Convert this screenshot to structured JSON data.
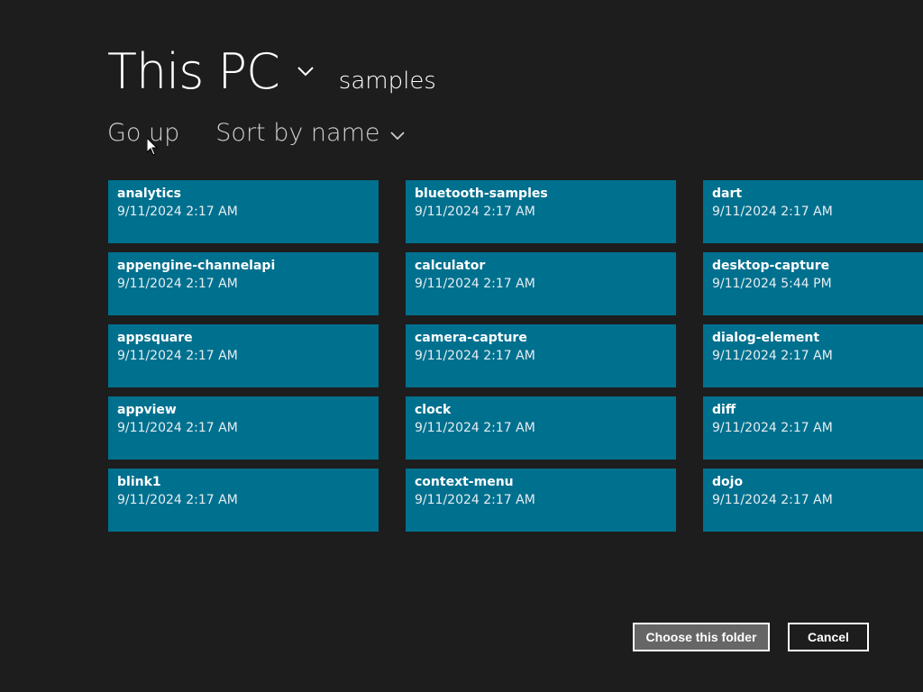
{
  "header": {
    "location": "This PC",
    "location_chevron_icon": "chevron-down-icon",
    "folder": "samples"
  },
  "commands": {
    "go_up": "Go up",
    "sort": "Sort by name",
    "sort_chevron_icon": "chevron-down-icon"
  },
  "colors": {
    "background": "#1d1d1d",
    "tile": "#00708f",
    "choose_button_bg": "#666666"
  },
  "folders": {
    "col1": [
      {
        "name": "analytics",
        "date": "9/11/2024 2:17 AM"
      },
      {
        "name": "appengine-channelapi",
        "date": "9/11/2024 2:17 AM"
      },
      {
        "name": "appsquare",
        "date": "9/11/2024 2:17 AM"
      },
      {
        "name": "appview",
        "date": "9/11/2024 2:17 AM"
      },
      {
        "name": "blink1",
        "date": "9/11/2024 2:17 AM"
      }
    ],
    "col2": [
      {
        "name": "bluetooth-samples",
        "date": "9/11/2024 2:17 AM"
      },
      {
        "name": "calculator",
        "date": "9/11/2024 2:17 AM"
      },
      {
        "name": "camera-capture",
        "date": "9/11/2024 2:17 AM"
      },
      {
        "name": "clock",
        "date": "9/11/2024 2:17 AM"
      },
      {
        "name": "context-menu",
        "date": "9/11/2024 2:17 AM"
      }
    ],
    "col3": [
      {
        "name": "dart",
        "date": "9/11/2024 2:17 AM"
      },
      {
        "name": "desktop-capture",
        "date": "9/11/2024 5:44 PM"
      },
      {
        "name": "dialog-element",
        "date": "9/11/2024 2:17 AM"
      },
      {
        "name": "diff",
        "date": "9/11/2024 2:17 AM"
      },
      {
        "name": "dojo",
        "date": "9/11/2024 2:17 AM"
      }
    ]
  },
  "buttons": {
    "choose": "Choose this folder",
    "cancel": "Cancel"
  }
}
